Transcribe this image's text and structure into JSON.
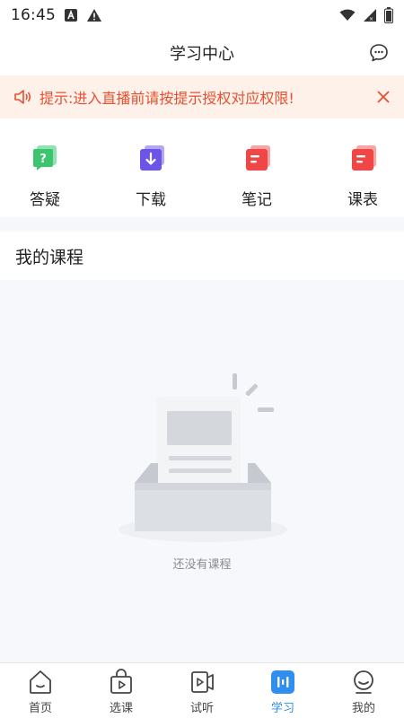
{
  "status_bar": {
    "time": "16:45",
    "icons": [
      "a-badge-icon",
      "warning-icon",
      "wifi-icon",
      "signal-icon",
      "battery-icon"
    ]
  },
  "header": {
    "title": "学习中心",
    "right_icon": "chat-bubble-icon"
  },
  "notice": {
    "text": "提示:进入直播前请按提示授权对应权限!",
    "color": "#e5502f",
    "background": "#fdf1ea"
  },
  "quick_menu": [
    {
      "label": "答疑",
      "icon": "question-icon",
      "color": "#3cc46f"
    },
    {
      "label": "下载",
      "icon": "download-icon",
      "color": "#6c55e6"
    },
    {
      "label": "笔记",
      "icon": "notes-icon",
      "color": "#f04646"
    },
    {
      "label": "课表",
      "icon": "schedule-icon",
      "color": "#f04646"
    }
  ],
  "section": {
    "title": "我的课程"
  },
  "empty_state": {
    "text": "还没有课程",
    "icon": "empty-inbox-illustration"
  },
  "tabbar": {
    "active_color": "#2e8ff0",
    "tabs": [
      {
        "label": "首页",
        "icon": "home-icon",
        "active": false
      },
      {
        "label": "选课",
        "icon": "shopping-bag-play-icon",
        "active": false
      },
      {
        "label": "试听",
        "icon": "video-listen-icon",
        "active": false
      },
      {
        "label": "学习",
        "icon": "study-icon",
        "active": true
      },
      {
        "label": "我的",
        "icon": "profile-icon",
        "active": false
      }
    ]
  }
}
